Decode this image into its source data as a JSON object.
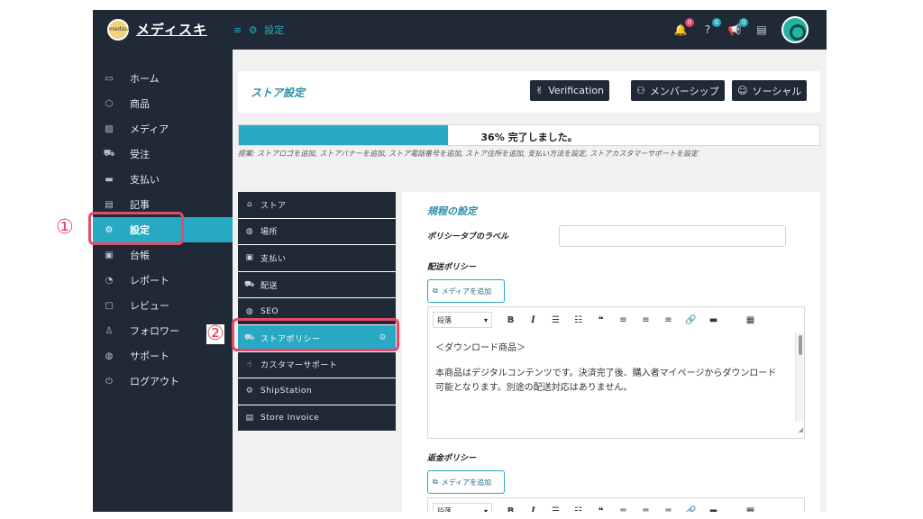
{
  "brand": {
    "logo_text": "medisuki",
    "name": "メディスキ"
  },
  "breadcrumb": {
    "menu_icon": "≡",
    "settings_icon": "⚙",
    "label": "設定"
  },
  "topbar": {
    "badges": [
      {
        "icon": "bell-icon",
        "glyph": "🔔",
        "count": "0",
        "color": "#e2436b"
      },
      {
        "icon": "help-icon",
        "glyph": "?",
        "count": "0",
        "color": "#27a9c4"
      },
      {
        "icon": "megaphone-icon",
        "glyph": "📢",
        "count": "0",
        "color": "#27a9c4"
      }
    ],
    "book_icon": "▤"
  },
  "sidebar": {
    "items": [
      {
        "label": "ホーム",
        "icon": "monitor-icon",
        "glyph": "▭"
      },
      {
        "label": "商品",
        "icon": "box-icon",
        "glyph": "⬡"
      },
      {
        "label": "メディア",
        "icon": "image-icon",
        "glyph": "▨"
      },
      {
        "label": "受注",
        "icon": "cart-icon",
        "glyph": "⛟"
      },
      {
        "label": "支払い",
        "icon": "card-icon",
        "glyph": "▬"
      },
      {
        "label": "記事",
        "icon": "document-icon",
        "glyph": "▤"
      },
      {
        "label": "設定",
        "icon": "gear-icon",
        "glyph": "⚙",
        "active": true
      },
      {
        "label": "台帳",
        "icon": "money-icon",
        "glyph": "▣"
      },
      {
        "label": "レポート",
        "icon": "chart-icon",
        "glyph": "◔"
      },
      {
        "label": "レビュー",
        "icon": "chat-icon",
        "glyph": "▢"
      },
      {
        "label": "フォロワー",
        "icon": "shirt-icon",
        "glyph": "♙"
      },
      {
        "label": "サポート",
        "icon": "globe-icon",
        "glyph": "◍"
      },
      {
        "label": "ログアウト",
        "icon": "power-icon",
        "glyph": "⏻"
      }
    ]
  },
  "header": {
    "title": "ストア設定",
    "buttons": [
      {
        "label": "Verification",
        "glyph": "✌"
      },
      {
        "label": "メンバーシップ",
        "glyph": "⚇"
      },
      {
        "label": "ソーシャル",
        "glyph": "☺"
      }
    ]
  },
  "progress": {
    "percent": 36,
    "text": "36%  完了しました。"
  },
  "suggestion": "提案: ストアロゴを追加, ストアバナーを追加, ストア電話番号を追加, ストア住所を追加, 支払い方法を設定, ストアカスタマーサポートを設定",
  "store_menu": {
    "items": [
      {
        "label": "ストア",
        "glyph": "⌂"
      },
      {
        "label": "場所",
        "glyph": "◍"
      },
      {
        "label": "支払い",
        "glyph": "▣"
      },
      {
        "label": "配送",
        "glyph": "⛟"
      },
      {
        "label": "SEO",
        "glyph": "◍"
      },
      {
        "label": "ストアポリシー",
        "glyph": "⛟",
        "active": true
      },
      {
        "label": "カスタマーサポート",
        "glyph": "☝"
      },
      {
        "label": "ShipStation",
        "glyph": "⚙"
      },
      {
        "label": "Store Invoice",
        "glyph": "▤"
      }
    ]
  },
  "policy": {
    "section_title": "規程の設定",
    "tab_label": "ポリシータブのラベル",
    "tab_label_value": "",
    "shipping_title": "配送ポリシー",
    "refund_title": "返金ポリシー",
    "add_media": "メディアを追加",
    "paragraph_select": "段落",
    "editor_p1": "＜ダウンロード商品＞",
    "editor_p2": "本商品はデジタルコンテンツです。決済完了後、購入者マイページからダウンロード可能となります。別途の配送対応はありません。"
  },
  "toolbar_glyphs": [
    "B",
    "I",
    "☰",
    "☷",
    "❝",
    "≡",
    "≡",
    "≡",
    "🔗",
    "▬",
    "▦"
  ],
  "callouts": {
    "one": "①",
    "two": "②"
  },
  "colors": {
    "accent": "#27a9c4",
    "dark": "#1f2a36",
    "highlight": "#e24a6a"
  }
}
